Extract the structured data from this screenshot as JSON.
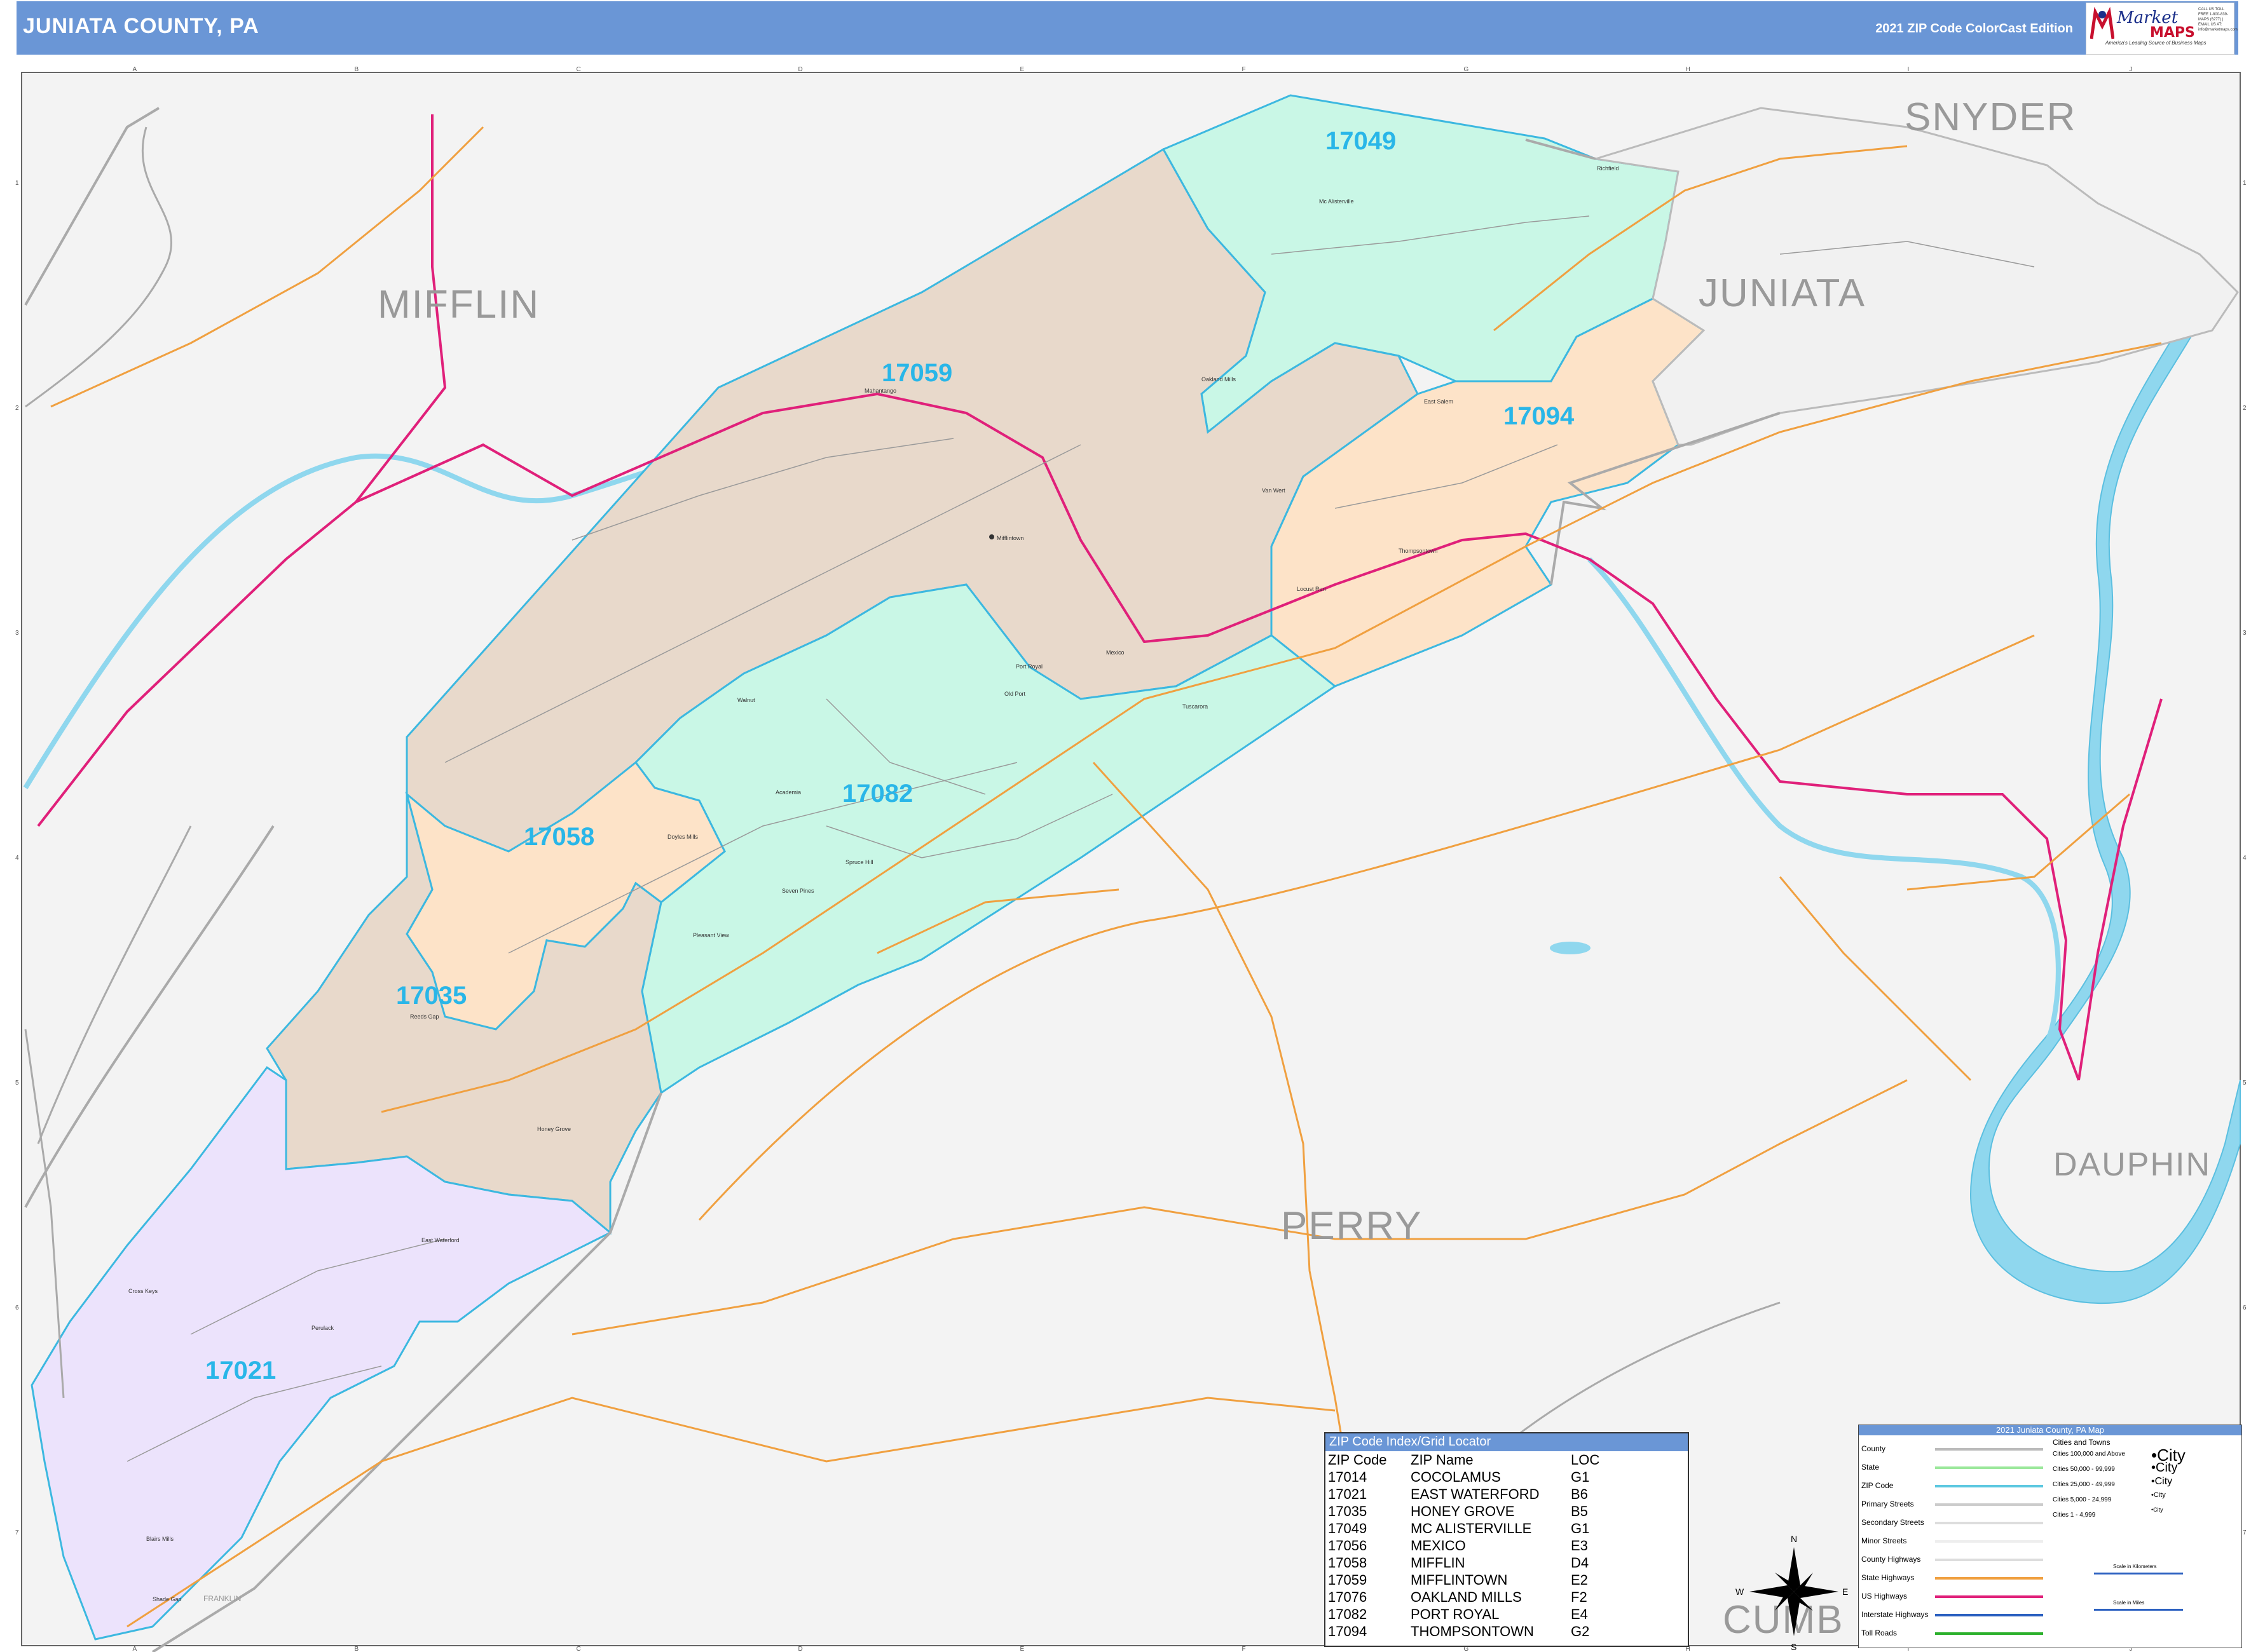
{
  "header": {
    "title": "JUNIATA COUNTY, PA",
    "edition": "2021 ZIP Code ColorCast Edition",
    "logo_name": "Market",
    "logo_maps": "MAPS",
    "logo_tagline": "America's Leading Source of Business Maps",
    "logo_contact": "CALL US TOLL FREE 1-800-839-MAPS (6277) | EMAIL US AT: info@marketmaps.com"
  },
  "counties": {
    "mifflin": "MIFFLIN",
    "snyder": "SNYDER",
    "juniata": "JUNIATA",
    "perry": "PERRY",
    "dauphin": "DAUPHIN",
    "cumb": "CUMB",
    "franklin": "FRANKLIN"
  },
  "zip_areas": [
    {
      "zip": "17049",
      "color": "#c9f7e6"
    },
    {
      "zip": "17059",
      "color": "#e8d9cb"
    },
    {
      "zip": "17094",
      "color": "#fde3c8"
    },
    {
      "zip": "17082",
      "color": "#c9f7e6"
    },
    {
      "zip": "17058",
      "color": "#fde3c8"
    },
    {
      "zip": "17035",
      "color": "#e8d9cb"
    },
    {
      "zip": "17021",
      "color": "#ece3fc"
    }
  ],
  "towns": {
    "mifflintown": "Mifflintown",
    "port_royal": "Port Royal",
    "mexico": "Mexico",
    "thompsontown": "Thompsontown",
    "mcalisterville": "Mc Alisterville",
    "east_waterford": "East Waterford",
    "honey_grove": "Honey Grove",
    "mifflin": "Mifflin",
    "academia": "Academia",
    "richfield": "Richfield",
    "oakland_mills": "Oakland Mills",
    "east_salem": "East Salem",
    "doyles_mills": "Doyles Mills",
    "spruce_hill": "Spruce Hill",
    "seven_pines": "Seven Pines",
    "pleasant_view": "Pleasant View",
    "cross_keys": "Cross Keys",
    "peru_mill": "Perulack",
    "van_wert": "Van Wert",
    "locust_run": "Locust Run",
    "walnut": "Walnut",
    "old_port": "Old Port",
    "mahantango": "Mahantango",
    "tuscarora": "Tuscarora",
    "reeds_gap": "Reeds Gap",
    "blairs_mills": "Blairs Mills",
    "shade_gap": "Shade Gap"
  },
  "compass": {
    "n": "N",
    "s": "S",
    "e": "E",
    "w": "W"
  },
  "grid": {
    "cols": [
      "A",
      "B",
      "C",
      "D",
      "E",
      "F",
      "G",
      "H",
      "I",
      "J"
    ],
    "rows": [
      "1",
      "2",
      "3",
      "4",
      "5",
      "6",
      "7"
    ]
  },
  "zip_index": {
    "title": "ZIP Code Index/Grid Locator",
    "headers": [
      "ZIP Code",
      "ZIP Name",
      "LOC"
    ],
    "rows": [
      [
        "17014",
        "COCOLAMUS",
        "G1"
      ],
      [
        "17021",
        "EAST WATERFORD",
        "B6"
      ],
      [
        "17035",
        "HONEY GROVE",
        "B5"
      ],
      [
        "17049",
        "MC ALISTERVILLE",
        "G1"
      ],
      [
        "17056",
        "MEXICO",
        "E3"
      ],
      [
        "17058",
        "MIFFLIN",
        "D4"
      ],
      [
        "17059",
        "MIFFLINTOWN",
        "E2"
      ],
      [
        "17076",
        "OAKLAND MILLS",
        "F2"
      ],
      [
        "17082",
        "PORT ROYAL",
        "E4"
      ],
      [
        "17094",
        "THOMPSONTOWN",
        "G2"
      ]
    ]
  },
  "legend": {
    "title": "2021 Juniata County, PA Map",
    "items": [
      {
        "label": "County",
        "color": "#bbbbbb"
      },
      {
        "label": "State",
        "color": "#9be89b"
      },
      {
        "label": "ZIP Code",
        "color": "#5cc8e0"
      },
      {
        "label": "Primary Streets",
        "color": "#cccccc"
      },
      {
        "label": "Secondary Streets",
        "color": "#dddddd"
      },
      {
        "label": "Minor Streets",
        "color": "#eeeeee"
      },
      {
        "label": "County Highways",
        "color": "#dddddd"
      },
      {
        "label": "State Highways",
        "color": "#f0a040"
      },
      {
        "label": "US Highways",
        "color": "#e0207a"
      },
      {
        "label": "Interstate Highways",
        "color": "#2a5fc0"
      },
      {
        "label": "Toll Roads",
        "color": "#2bb02b"
      }
    ],
    "cities_title": "Cities and Towns",
    "cities": [
      {
        "label": "Cities 100,000 and Above",
        "sample": "•City"
      },
      {
        "label": "Cities 50,000 - 99,999",
        "sample": "•City"
      },
      {
        "label": "Cities 25,000 - 49,999",
        "sample": "•City"
      },
      {
        "label": "Cities 5,000 - 24,999",
        "sample": "•City"
      },
      {
        "label": "Cities 1 - 4,999",
        "sample": "•City"
      }
    ],
    "scale_km": "Scale in Kilometers",
    "scale_mi": "Scale in Miles"
  }
}
